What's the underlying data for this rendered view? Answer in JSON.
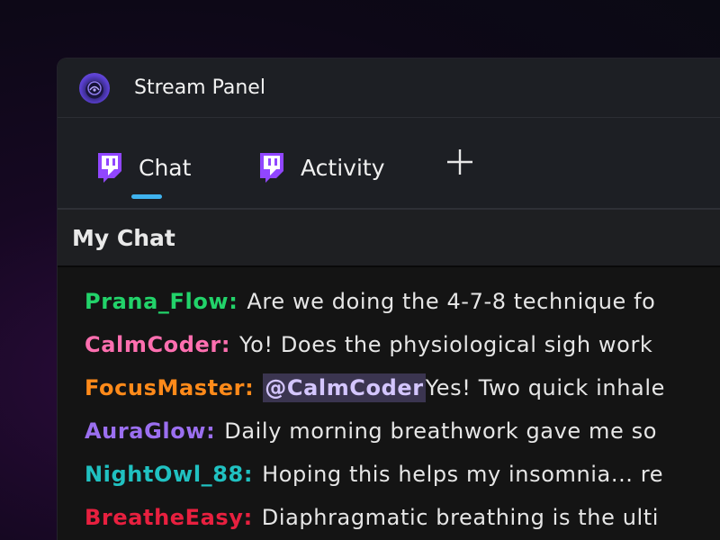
{
  "window": {
    "title": "Stream Panel"
  },
  "tabs": [
    {
      "label": "Chat",
      "icon": "twitch-icon",
      "active": true
    },
    {
      "label": "Activity",
      "icon": "twitch-icon",
      "active": false
    }
  ],
  "add_tab_icon": "plus-icon",
  "chat_header": {
    "title": "My Chat"
  },
  "messages": [
    {
      "user": "Prana_Flow",
      "color": "#22d36a",
      "text": "Are we doing the 4-7-8 technique fo"
    },
    {
      "user": "CalmCoder",
      "color": "#ff6fb0",
      "text": "Yo! Does the physiological sigh work"
    },
    {
      "user": "FocusMaster",
      "color": "#ff8a1a",
      "mention": "@CalmCoder",
      "text": "Yes! Two quick inhale"
    },
    {
      "user": "AuraGlow",
      "color": "#9b6ff0",
      "text": "Daily morning breathwork gave me so"
    },
    {
      "user": "NightOwl_88",
      "color": "#20c1c1",
      "text": "Hoping this helps my insomnia... re"
    },
    {
      "user": "BreatheEasy",
      "color": "#e8203f",
      "text": "Diaphragmatic breathing is the ulti"
    }
  ],
  "colors": {
    "accent": "#3fb3ef",
    "twitch_purple": "#9146ff",
    "mention_bg": "#3b3550"
  }
}
